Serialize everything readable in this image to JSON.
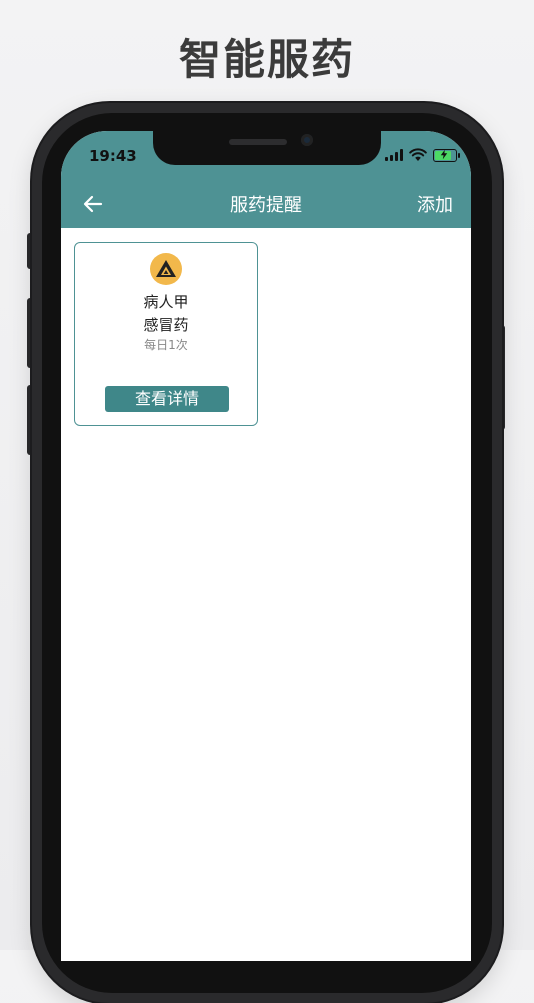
{
  "promo": {
    "title": "智能服药"
  },
  "status_bar": {
    "time": "19:43"
  },
  "nav": {
    "title": "服药提醒",
    "add_label": "添加"
  },
  "colors": {
    "header": "#4e9294",
    "button": "#3f8789",
    "avatar": "#f2b84b"
  },
  "icons": {
    "back": "arrow-left-icon",
    "avatar": "triangle-logo-icon"
  },
  "reminders": [
    {
      "patient": "病人甲",
      "medicine": "感冒药",
      "frequency": "每日1次",
      "button_label": "查看详情"
    }
  ]
}
